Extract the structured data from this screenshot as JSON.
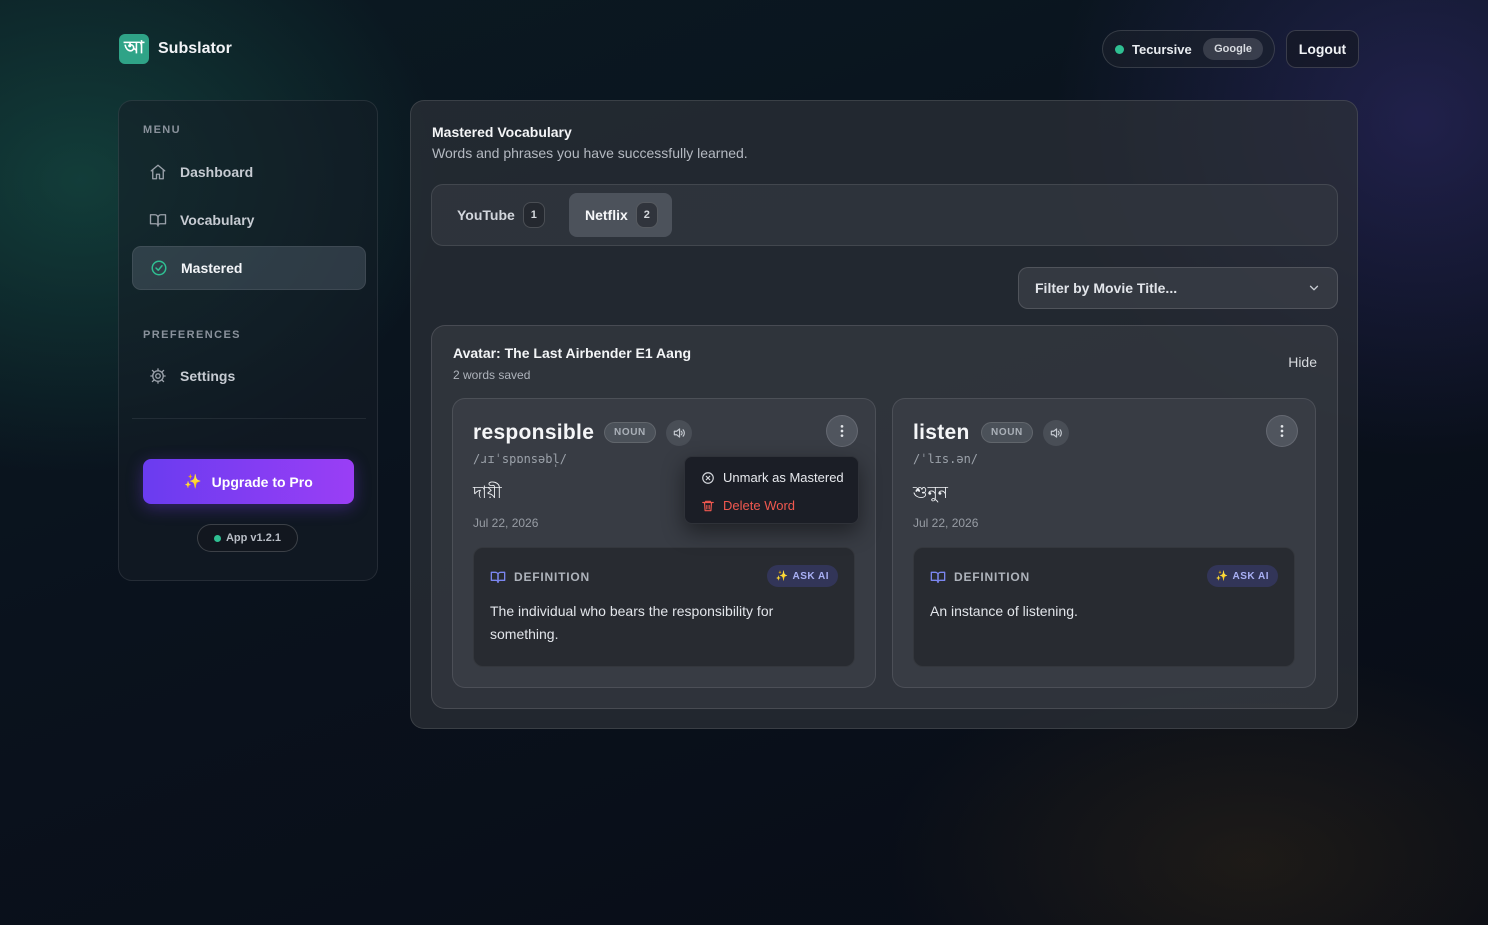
{
  "app": {
    "logo_glyph": "আ",
    "name": "Subslator"
  },
  "header": {
    "user_name": "Tecursive",
    "provider": "Google",
    "logout_label": "Logout",
    "status_color": "#2fbf92"
  },
  "sidebar": {
    "menu_heading": "MENU",
    "items": [
      {
        "label": "Dashboard",
        "icon": "home-icon",
        "active": false
      },
      {
        "label": "Vocabulary",
        "icon": "book-icon",
        "active": false
      },
      {
        "label": "Mastered",
        "icon": "check-circle-icon",
        "active": true
      }
    ],
    "preferences_heading": "PREFERENCES",
    "settings_label": "Settings",
    "upgrade_label": "Upgrade to Pro",
    "version_label": "App v1.2.1"
  },
  "main": {
    "title": "Mastered Vocabulary",
    "subtitle": "Words and phrases you have successfully learned.",
    "tabs": [
      {
        "label": "YouTube",
        "count": "1",
        "active": false
      },
      {
        "label": "Netflix",
        "count": "2",
        "active": true
      }
    ],
    "filter_label": "Filter by Movie Title...",
    "group": {
      "title": "Avatar: The Last Airbender E1 Aang",
      "subtitle": "2 words saved",
      "hide_label": "Hide",
      "cards": [
        {
          "word": "responsible",
          "pos": "NOUN",
          "ipa": "/ɹɪˈspɒnsəbl̩/",
          "translation": "দায়ী",
          "date": "Jul 22, 2026",
          "definition_label": "DEFINITION",
          "ask_ai_label": "ASK AI",
          "definition": "The individual who bears the responsibility for something."
        },
        {
          "word": "listen",
          "pos": "NOUN",
          "ipa": "/ˈlɪs.ən/",
          "translation": "শুনুন",
          "date": "Jul 22, 2026",
          "definition_label": "DEFINITION",
          "ask_ai_label": "ASK AI",
          "definition": "An instance of listening."
        }
      ],
      "context_menu": {
        "unmark_label": "Unmark as Mastered",
        "delete_label": "Delete Word",
        "delete_color": "#f0584f"
      }
    }
  },
  "colors": {
    "accent": "#2fa387",
    "upgrade_start": "#6a3cf0",
    "upgrade_end": "#9a3ef5"
  }
}
